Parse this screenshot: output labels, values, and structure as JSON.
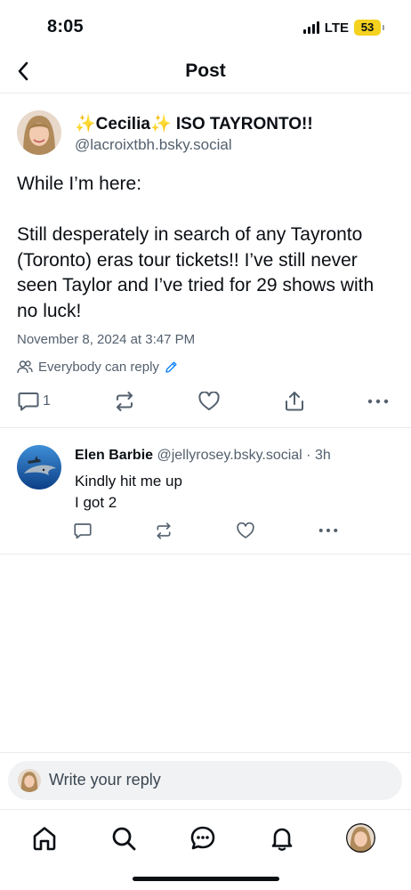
{
  "status_bar": {
    "time": "8:05",
    "network": "LTE",
    "battery": "53",
    "battery_color": "#f4d21f"
  },
  "header": {
    "title": "Post",
    "back_icon": "chevron-left-icon"
  },
  "post": {
    "author_name_prefix": "✨",
    "author_name_main": "Cecilia",
    "author_name_mid": "✨",
    "author_name_suffix": " ISO TAYRONTO!!",
    "author_handle": "@lacroixtbh.bsky.social",
    "body": "While I’m here:\n\nStill desperately in search of any Tayronto (Toronto) eras tour tickets!! I’ve still never seen Taylor and I’ve tried for 29 shows with no luck!",
    "date": "November 8, 2024 at 3:47 PM",
    "reply_setting": "Everybody can reply",
    "reply_count": "1"
  },
  "reply": {
    "author_name": "Elen Barbie",
    "author_handle": "@jellyrosey.bsky.social",
    "separator": " · ",
    "time_ago": "3h",
    "body": "Kindly hit me up\nI got 2"
  },
  "compose": {
    "placeholder": "Write your reply"
  },
  "nav": {
    "items": [
      "home-icon",
      "search-icon",
      "chat-icon",
      "bell-icon",
      "profile-avatar"
    ]
  },
  "colors": {
    "accent": "#1083fe",
    "secondary_text": "#53606e",
    "icon": "#53606e"
  }
}
